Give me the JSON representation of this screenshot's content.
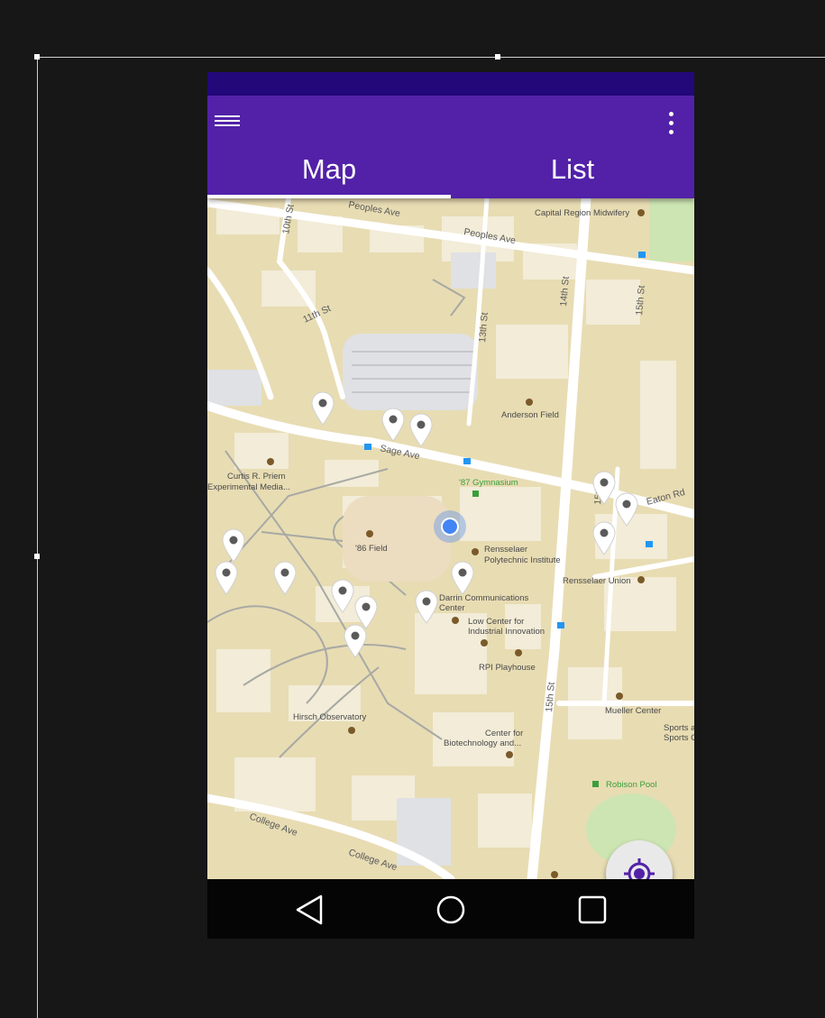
{
  "app_bar": {
    "menu_icon": "hamburger-menu-icon",
    "overflow_icon": "more-vert-icon",
    "tabs": [
      {
        "label": "Map",
        "active": true
      },
      {
        "label": "List",
        "active": false
      }
    ]
  },
  "map": {
    "streets": [
      "Peoples Ave",
      "Peoples Ave",
      "10th St",
      "11th St",
      "13th St",
      "14th St",
      "15th St",
      "15th St",
      "15th St",
      "Sage Ave",
      "Eaton Rd",
      "College Ave",
      "College Ave"
    ],
    "places": [
      "Capital Region Midwifery",
      "Anderson Field",
      "'87 Gymnasium",
      "Curtis R. Priem",
      "Experimental Media...",
      "'86 Field",
      "Rensselaer",
      "Polytechnic Institute",
      "Rensselaer Union",
      "Darrin Communications",
      "Center",
      "Low Center for",
      "Industrial Innovation",
      "RPI Playhouse",
      "Hirsch Observatory",
      "Center for",
      "Biotechnology and...",
      "Mueller Center",
      "Sports a",
      "Sports Cen",
      "Robison Pool"
    ],
    "marker_icon": "map-pin-icon",
    "location_dot_icon": "current-location-dot"
  },
  "fabs": {
    "locate_icon": "gps-crosshair-icon",
    "add_label": "+"
  },
  "nav_bar": {
    "back_icon": "back-triangle-icon",
    "home_icon": "home-circle-icon",
    "recents_icon": "recents-square-icon"
  },
  "colors": {
    "primary": "#5221a8",
    "status_bar": "#23087a",
    "map_land": "#e8dcb3",
    "map_road": "#ffffff",
    "location_blue": "#4285f4"
  }
}
